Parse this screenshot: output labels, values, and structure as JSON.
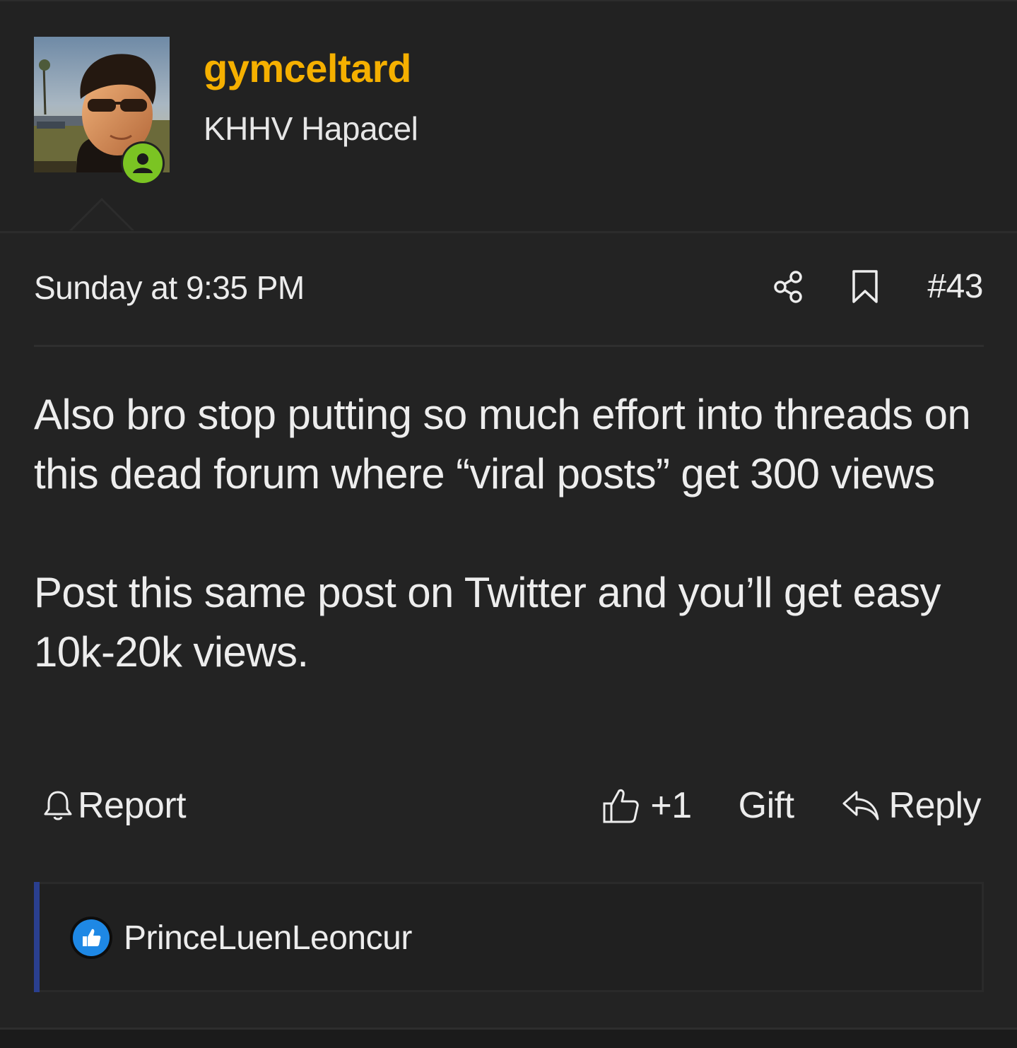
{
  "post": {
    "author": {
      "username": "gymceltard",
      "title": "KHHV Hapacel",
      "online_icon": "user-online-icon",
      "username_color": "#f5b000"
    },
    "meta": {
      "date": "Sunday at 9:35 PM",
      "share_icon": "share-icon",
      "bookmark_icon": "bookmark-icon",
      "post_number": "#43"
    },
    "body": {
      "paragraphs": [
        "Also bro stop putting so much effort into threads on this dead forum where “viral posts” get 300 views",
        "Post this same post on Twitter and you’ll get easy 10k-20k views."
      ]
    },
    "actions": {
      "report_label": "Report",
      "like_label": "+1",
      "gift_label": "Gift",
      "reply_label": "Reply"
    },
    "reactions": {
      "user": "PrinceLuenLeoncur",
      "reaction_icon": "thumbs-up-icon",
      "accent_color": "#2a3f8f"
    }
  }
}
